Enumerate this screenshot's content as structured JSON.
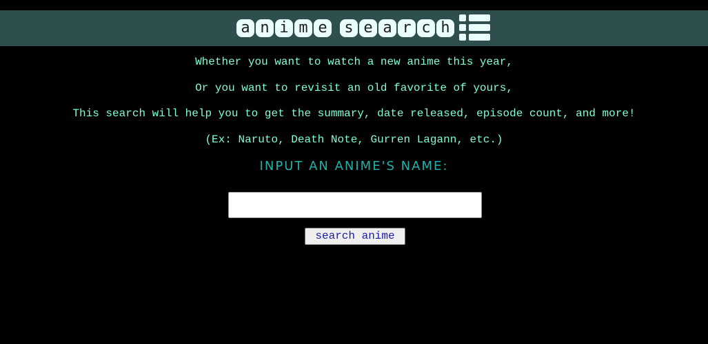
{
  "header": {
    "logo_word_1": [
      "a",
      "n",
      "i",
      "m",
      "e"
    ],
    "logo_word_2": [
      "s",
      "e",
      "a",
      "r",
      "c",
      "h"
    ],
    "logo_icon": "list-icon",
    "background": "#2f4f4f"
  },
  "intro": {
    "line1": "Whether you want to watch a new anime this year,",
    "line2": "Or you want to revisit an old favorite of yours,",
    "line3": "This search will help you to get the summary, date released, episode count, and more!",
    "line4": "(Ex: Naruto, Death Note, Gurren Lagann, etc.)"
  },
  "form": {
    "prompt": "INPUT AN ANIME'S NAME:",
    "input_value": "",
    "input_placeholder": "",
    "button_label": "search anime"
  },
  "colors": {
    "page_background": "#000000",
    "intro_text": "#7fffd4",
    "prompt_text": "#20b2aa",
    "logo_tile": "#eafffb"
  }
}
